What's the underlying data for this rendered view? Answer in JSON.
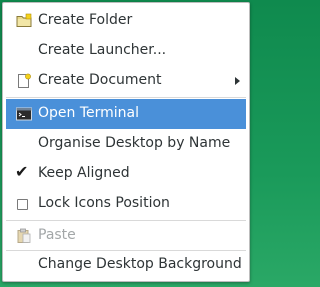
{
  "menu": {
    "items": [
      {
        "label": "Create Folder",
        "icon": "folder-new-icon"
      },
      {
        "label": "Create Launcher...",
        "icon": ""
      },
      {
        "label": "Create Document",
        "icon": "document-new-icon",
        "submenu": true
      },
      {
        "label": "Open Terminal",
        "icon": "terminal-icon",
        "highlighted": true
      },
      {
        "label": "Organise Desktop by Name"
      },
      {
        "label": "Keep Aligned",
        "checked": true
      },
      {
        "label": "Lock Icons Position",
        "checked": false
      },
      {
        "label": "Paste",
        "icon": "paste-icon",
        "disabled": true
      },
      {
        "label": "Change Desktop Background"
      }
    ]
  },
  "colors": {
    "highlight": "#4a90d9",
    "desktop_background": "#0f8a4e",
    "menu_background": "#ffffff",
    "text": "#2e3436",
    "disabled_text": "#a3a7a8"
  }
}
